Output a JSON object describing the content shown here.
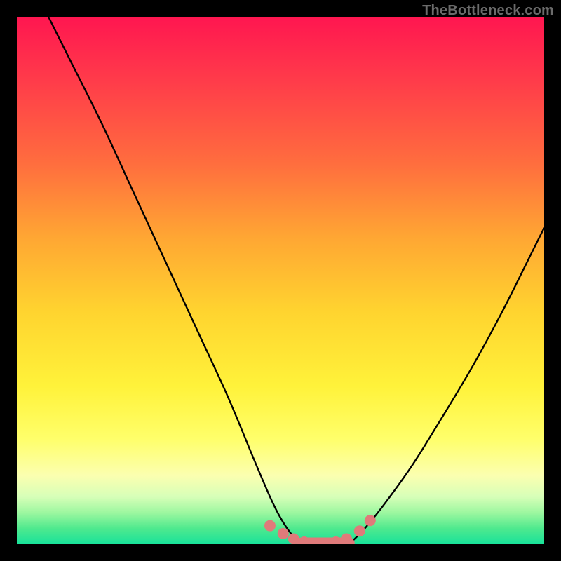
{
  "watermark": "TheBottleneck.com",
  "chart_data": {
    "type": "line",
    "title": "",
    "xlabel": "",
    "ylabel": "",
    "xlim": [
      0,
      100
    ],
    "ylim": [
      0,
      100
    ],
    "series": [
      {
        "name": "left-curve",
        "x": [
          6,
          10,
          16,
          22,
          28,
          34,
          40,
          45,
          48,
          50,
          52,
          54
        ],
        "values": [
          100,
          92,
          80,
          67,
          54,
          41,
          28,
          16,
          9,
          5,
          2,
          0
        ]
      },
      {
        "name": "right-curve",
        "x": [
          63,
          66,
          70,
          75,
          80,
          86,
          92,
          98,
          100
        ],
        "values": [
          0,
          3,
          8,
          15,
          23,
          33,
          44,
          56,
          60
        ]
      }
    ],
    "markers": {
      "name": "bottom-dots",
      "x": [
        48,
        50.5,
        52.5,
        54.5,
        56.5,
        58.5,
        60.5,
        62.5,
        65,
        67
      ],
      "values": [
        3.5,
        2.0,
        1.0,
        0.4,
        0.2,
        0.2,
        0.4,
        1.0,
        2.5,
        4.5
      ]
    },
    "flat_segment": {
      "x0": 54,
      "x1": 63,
      "y": 0.2
    },
    "gradient_stops": [
      {
        "pos": 0,
        "color": "#ff1650"
      },
      {
        "pos": 12,
        "color": "#ff3b4a"
      },
      {
        "pos": 28,
        "color": "#ff6e3e"
      },
      {
        "pos": 42,
        "color": "#ffa733"
      },
      {
        "pos": 56,
        "color": "#ffd42f"
      },
      {
        "pos": 70,
        "color": "#fff23a"
      },
      {
        "pos": 80,
        "color": "#ffff6a"
      },
      {
        "pos": 87,
        "color": "#fbffb0"
      },
      {
        "pos": 91,
        "color": "#d7ffb8"
      },
      {
        "pos": 94,
        "color": "#9df7a0"
      },
      {
        "pos": 97,
        "color": "#4fe98e"
      },
      {
        "pos": 100,
        "color": "#18e29a"
      }
    ]
  }
}
